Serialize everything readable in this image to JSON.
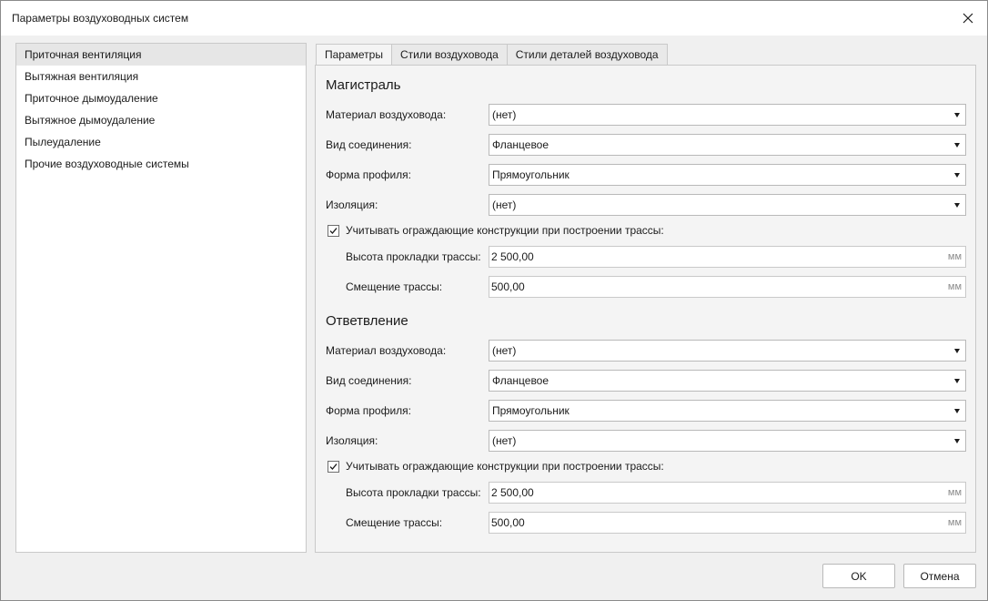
{
  "window": {
    "title": "Параметры воздуховодных систем",
    "close_icon": "close-icon"
  },
  "sidebar": {
    "items": [
      {
        "label": "Приточная вентиляция",
        "selected": true
      },
      {
        "label": "Вытяжная вентиляция",
        "selected": false
      },
      {
        "label": "Приточное дымоудаление",
        "selected": false
      },
      {
        "label": "Вытяжное дымоудаление",
        "selected": false
      },
      {
        "label": "Пылеудаление",
        "selected": false
      },
      {
        "label": "Прочие воздуховодные системы",
        "selected": false
      }
    ]
  },
  "tabs": [
    {
      "label": "Параметры",
      "active": true
    },
    {
      "label": "Стили воздуховода",
      "active": false
    },
    {
      "label": "Стили деталей воздуховода",
      "active": false
    }
  ],
  "main_section": {
    "title": "Магистраль",
    "material_label": "Материал воздуховода:",
    "material_value": "(нет)",
    "connection_label": "Вид соединения:",
    "connection_value": "Фланцевое",
    "profile_label": "Форма профиля:",
    "profile_value": "Прямоугольник",
    "insulation_label": "Изоляция:",
    "insulation_value": "(нет)",
    "consider_label": "Учитывать ограждающие конструкции при построении трассы:",
    "consider_checked": true,
    "height_label": "Высота прокладки трассы:",
    "height_value": "2 500,00",
    "height_unit": "мм",
    "offset_label": "Смещение трассы:",
    "offset_value": "500,00",
    "offset_unit": "мм"
  },
  "branch_section": {
    "title": "Ответвление",
    "material_label": "Материал воздуховода:",
    "material_value": "(нет)",
    "connection_label": "Вид соединения:",
    "connection_value": "Фланцевое",
    "profile_label": "Форма профиля:",
    "profile_value": "Прямоугольник",
    "insulation_label": "Изоляция:",
    "insulation_value": "(нет)",
    "consider_label": "Учитывать ограждающие конструкции при построении трассы:",
    "consider_checked": true,
    "height_label": "Высота прокладки трассы:",
    "height_value": "2 500,00",
    "height_unit": "мм",
    "offset_label": "Смещение трассы:",
    "offset_value": "500,00",
    "offset_unit": "мм"
  },
  "buttons": {
    "ok_label": "OK",
    "cancel_label": "Отмена"
  }
}
